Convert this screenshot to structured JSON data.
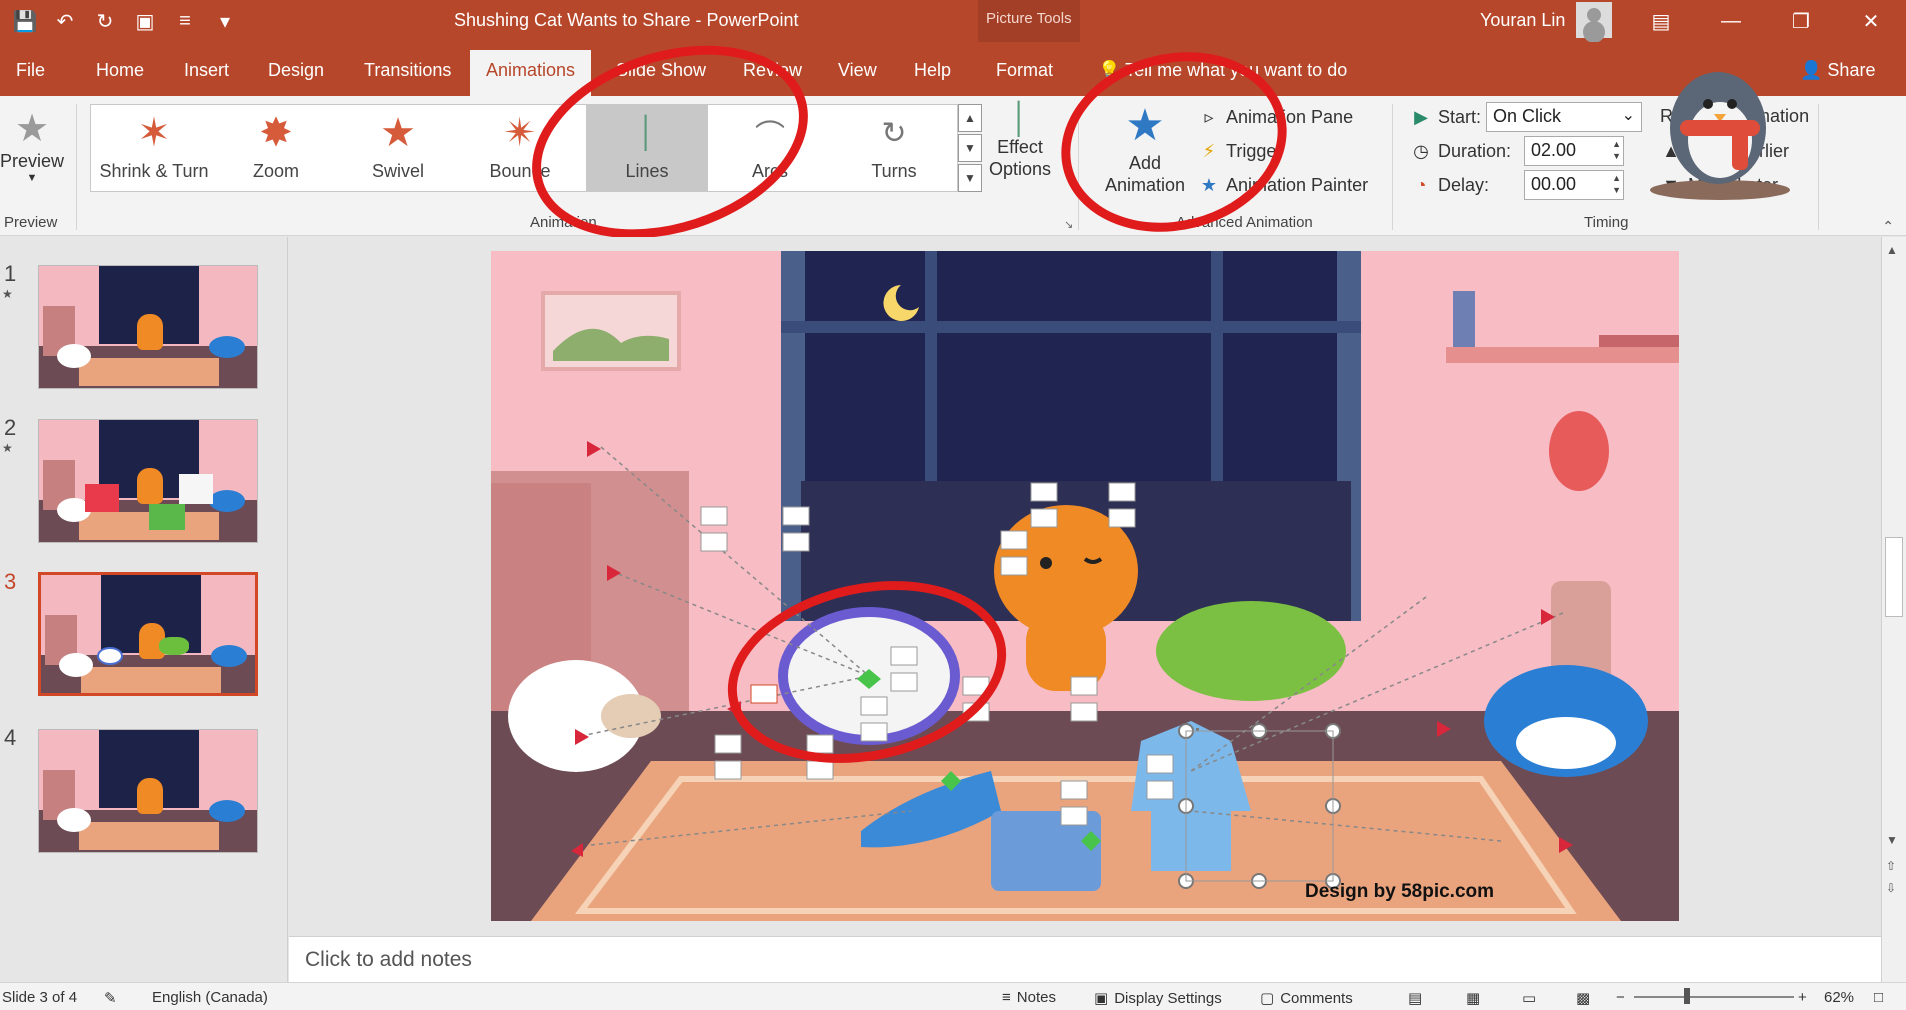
{
  "window": {
    "doc_title": "Shushing Cat Wants to Share  -  PowerPoint",
    "context_tools": "Picture Tools",
    "user_name": "Youran Lin"
  },
  "tabs": [
    "File",
    "Home",
    "Insert",
    "Design",
    "Transitions",
    "Animations",
    "Slide Show",
    "Review",
    "View",
    "Help",
    "Format"
  ],
  "active_tab": "Animations",
  "tell_me": "Tell me what you want to do",
  "share_label": "Share",
  "ribbon": {
    "preview": {
      "label": "Preview",
      "group": "Preview"
    },
    "animation_gallery": {
      "group": "Animation",
      "items": [
        "Shrink & Turn",
        "Zoom",
        "Swivel",
        "Bounce",
        "Lines",
        "Arcs",
        "Turns"
      ],
      "selected": "Lines"
    },
    "effect_options": "Effect Options",
    "advanced": {
      "group": "Advanced Animation",
      "add_animation": "Add Animation",
      "animation_pane": "Animation Pane",
      "trigger": "Trigger",
      "animation_painter": "Animation Painter"
    },
    "timing": {
      "group": "Timing",
      "start_label": "Start:",
      "start_value": "On Click",
      "duration_label": "Duration:",
      "duration_value": "02.00",
      "delay_label": "Delay:",
      "delay_value": "00.00",
      "reorder": "Reorder Animation",
      "move_earlier": "Move Earlier",
      "move_later": "Move Later"
    }
  },
  "slides": [
    {
      "num": "1",
      "star": "★"
    },
    {
      "num": "2",
      "star": "★"
    },
    {
      "num": "3",
      "star": ""
    },
    {
      "num": "4",
      "star": ""
    }
  ],
  "active_slide": 3,
  "slide_watermark": "Design by 58pic.com",
  "notes_placeholder": "Click to add notes",
  "status": {
    "slide_info": "Slide 3 of 4",
    "language": "English (Canada)",
    "notes": "Notes",
    "display_settings": "Display Settings",
    "comments": "Comments",
    "zoom": "62%"
  },
  "colors": {
    "accent": "#b7472a",
    "annotation": "#e01b1b"
  }
}
